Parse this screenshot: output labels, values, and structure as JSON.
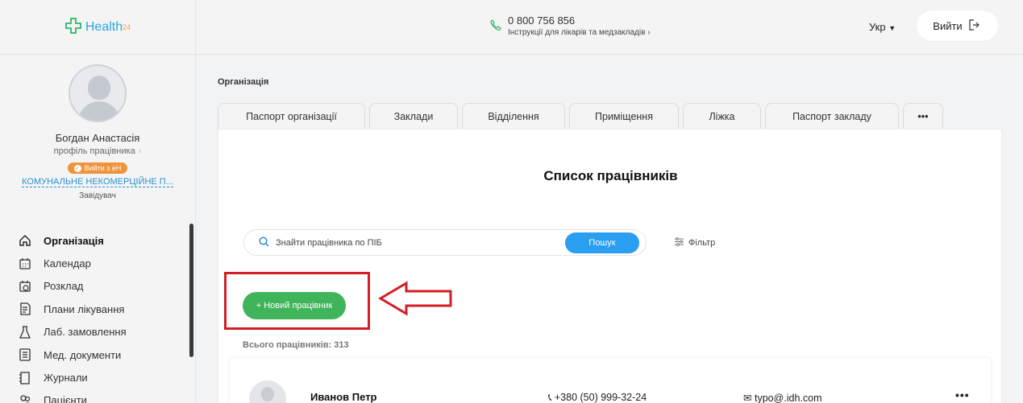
{
  "logo": {
    "name": "Health",
    "sup": "24"
  },
  "header": {
    "phone": "0 800 756 856",
    "instructions": "Інструкції для лікарів та медзакладів",
    "lang": "Укр",
    "logout": "Вийти"
  },
  "profile": {
    "name": "Богдан Анастасія",
    "link": "профіль працівника",
    "exit_badge": "Вийти з еН",
    "org": "КОМУНАЛЬНЕ НЕКОМЕРЦІЙНЕ П...",
    "position": "Завідувач"
  },
  "menu": [
    {
      "label": "Організація",
      "icon": "home-icon"
    },
    {
      "label": "Календар",
      "icon": "calendar-icon"
    },
    {
      "label": "Розклад",
      "icon": "schedule-icon"
    },
    {
      "label": "Плани лікування",
      "icon": "treatment-plan-icon"
    },
    {
      "label": "Лаб. замовлення",
      "icon": "flask-icon"
    },
    {
      "label": "Мед. документи",
      "icon": "document-icon"
    },
    {
      "label": "Журнали",
      "icon": "journal-icon"
    },
    {
      "label": "Пацієнти",
      "icon": "patients-icon"
    }
  ],
  "breadcrumb": "Організація",
  "tabs": [
    "Паспорт організації",
    "Заклади",
    "Відділення",
    "Приміщення",
    "Ліжка",
    "Паспорт закладу",
    "•••"
  ],
  "main": {
    "title": "Список працівників",
    "search_placeholder": "Знайти працівника по ПІБ",
    "search_button": "Пошук",
    "filter": "Фільтр",
    "new_button": "+ Новий працівник",
    "total": "Всього працівників: 313"
  },
  "employees": [
    {
      "name": "Иванов Петр",
      "phone": "+380 (50) 999-32-24",
      "email": "typo@.idh.com"
    }
  ],
  "colors": {
    "primary": "#2a9ef0",
    "green": "#3fb45a",
    "highlight": "#d21f26",
    "badge": "#f0943b"
  }
}
